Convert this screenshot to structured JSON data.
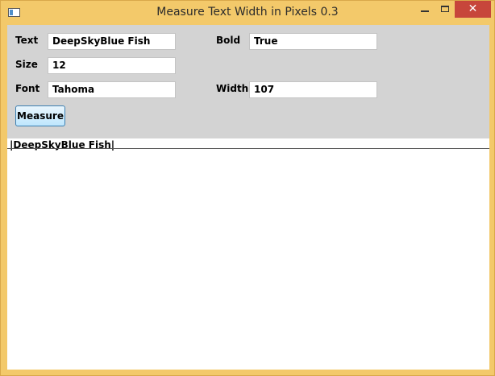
{
  "window": {
    "title": "Measure Text Width in Pixels 0.3",
    "minimize_glyph": "—",
    "maximize_glyph": "□",
    "close_glyph": "✕"
  },
  "form": {
    "text_label": "Text",
    "text_value": "DeepSkyBlue Fish",
    "size_label": "Size",
    "size_value": "12",
    "font_label": "Font",
    "font_value": "Tahoma",
    "bold_label": "Bold",
    "bold_value": "True",
    "width_label": "Width",
    "width_value": "107",
    "measure_label": "Measure"
  },
  "canvas": {
    "sample_text": "|DeepSkyBlue Fish|"
  },
  "colors": {
    "frame": "#f3c96a",
    "panel": "#d3d3d3",
    "close": "#c7463b"
  }
}
